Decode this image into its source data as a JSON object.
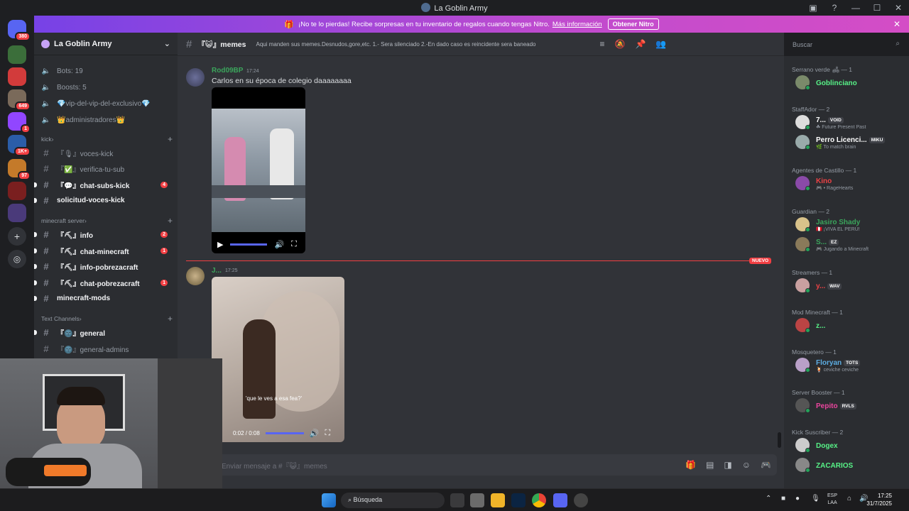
{
  "window": {
    "title": "La Goblin Army",
    "controls": [
      "—",
      "☐",
      "✕"
    ]
  },
  "banner": {
    "text": "¡No te lo pierdas! Recibe sorpresas en tu inventario de regalos cuando tengas Nitro.",
    "link": "Más información",
    "button": "Obtener Nitro",
    "accent": "#b84bd1"
  },
  "server_rail": [
    {
      "badge": "380",
      "color": "#5865f2"
    },
    {
      "badge": "",
      "color": "#3b6e3a"
    },
    {
      "badge": "",
      "color": "#d23b3b"
    },
    {
      "badge": "649",
      "color": "#7a6a5a"
    },
    {
      "badge": "1",
      "color": "#9146ff"
    },
    {
      "badge": "1K+",
      "color": "#2b5da8"
    },
    {
      "badge": "97",
      "color": "#c47a2a"
    },
    {
      "badge": "",
      "color": "#7a1f1f"
    },
    {
      "badge": "",
      "color": "#4a3a7a"
    }
  ],
  "sidebar": {
    "server_name": "La Goblin Army",
    "stats": [
      {
        "label": "Bots: 19"
      },
      {
        "label": "Boosts: 5"
      },
      {
        "label": "💎vip-del-vip-del-exclusivo💎"
      },
      {
        "label": "👑administradores👑"
      }
    ],
    "categories": [
      {
        "name": "kick",
        "channels": [
          {
            "name": "『🎙』voces-kick",
            "unread": false,
            "mention": ""
          },
          {
            "name": "『✅』verifica-tu-sub",
            "unread": false,
            "mention": ""
          },
          {
            "name": "『💬』chat-subs-kick",
            "unread": true,
            "mention": "4"
          },
          {
            "name": "solicitud-voces-kick",
            "unread": true,
            "mention": ""
          }
        ]
      },
      {
        "name": "minecraft server",
        "channels": [
          {
            "name": "『⛏』info",
            "unread": true,
            "mention": "2"
          },
          {
            "name": "『⛏』chat-minecraft",
            "unread": true,
            "mention": "1"
          },
          {
            "name": "『⛏』info-pobrezacraft",
            "unread": true,
            "mention": ""
          },
          {
            "name": "『⛏』chat-pobrezacraft",
            "unread": true,
            "mention": "1"
          },
          {
            "name": "minecraft-mods",
            "unread": true,
            "mention": ""
          }
        ]
      },
      {
        "name": "Text Channels",
        "channels": [
          {
            "name": "『🌚』general",
            "unread": true,
            "mention": ""
          },
          {
            "name": "『🌚』general-admins",
            "unread": false,
            "mention": ""
          }
        ]
      }
    ]
  },
  "channel_header": {
    "name": "『😺』memes",
    "topic": "Aqui manden sus memes.Desnudos,gore,etc. 1.- Sera silenciado 2.-En dado caso es reincidente sera baneado",
    "search_placeholder": "Buscar"
  },
  "messages": [
    {
      "author": "Rod09BP",
      "time": "17:24",
      "text": "Carlos en su época de colegio daaaaaaaa",
      "author_color": "#3ba55c"
    },
    {
      "author": "J...",
      "time": "17:25",
      "text": "",
      "author_color": "#3ba55c",
      "video_time": "0:02 / 0:08",
      "caption": "'que le ves a esa fea?'"
    }
  ],
  "new_divider": "NUEVO",
  "composer": {
    "placeholder": "Enviar mensaje a #『😺』memes"
  },
  "members": [
    {
      "group": "Serrano verde 🛋 — 1",
      "items": [
        {
          "name": "Goblinciano",
          "sub": "",
          "tag": "",
          "color": "#57f287"
        }
      ]
    },
    {
      "group": "StaffAdor — 2",
      "items": [
        {
          "name": "7...",
          "sub": "☘ Future Present Past",
          "tag": "VOID",
          "color": "#ffffff"
        },
        {
          "name": "Perro Licenci...",
          "sub": "🌿 To match brain",
          "tag": "MIKU",
          "color": "#ffffff"
        }
      ]
    },
    {
      "group": "Agentes de Castillo — 1",
      "items": [
        {
          "name": "Kino",
          "sub": "🎮 • RageHearts",
          "tag": "",
          "color": "#ed4245"
        }
      ]
    },
    {
      "group": "Guardian — 2",
      "items": [
        {
          "name": "Jasiro Shady",
          "sub": "🇵🇪 ¡VIVA EL PERÚ!",
          "tag": "",
          "color": "#3ba55c"
        },
        {
          "name": "S...",
          "sub": "🎮 Jugando a Minecraft",
          "tag": "EZ",
          "color": "#3ba55c"
        }
      ]
    },
    {
      "group": "Streamers — 1",
      "items": [
        {
          "name": "y...",
          "sub": "",
          "tag": "WAV",
          "color": "#ed4245"
        }
      ]
    },
    {
      "group": "Mod Minecraft — 1",
      "items": [
        {
          "name": "z...",
          "sub": "",
          "tag": "",
          "color": "#57f287"
        }
      ]
    },
    {
      "group": "Mosquetero — 1",
      "items": [
        {
          "name": "Floryan",
          "sub": "🍹 ceviche ceviche",
          "tag": "TOTS",
          "color": "#5dade2"
        }
      ]
    },
    {
      "group": "Server Booster — 1",
      "items": [
        {
          "name": "Pepito",
          "sub": "",
          "tag": "RVLS",
          "color": "#eb459e"
        }
      ]
    },
    {
      "group": "Kick Suscriber — 2",
      "items": [
        {
          "name": "Dogex",
          "sub": "",
          "tag": "",
          "color": "#57f287"
        },
        {
          "name": "ZACARIOS",
          "sub": "",
          "tag": "",
          "color": "#57f287"
        }
      ]
    }
  ],
  "taskbar": {
    "search": "Búsqueda",
    "lang": "ESP",
    "lang2": "LAA",
    "time": "17:25",
    "date": "31/7/2025"
  }
}
